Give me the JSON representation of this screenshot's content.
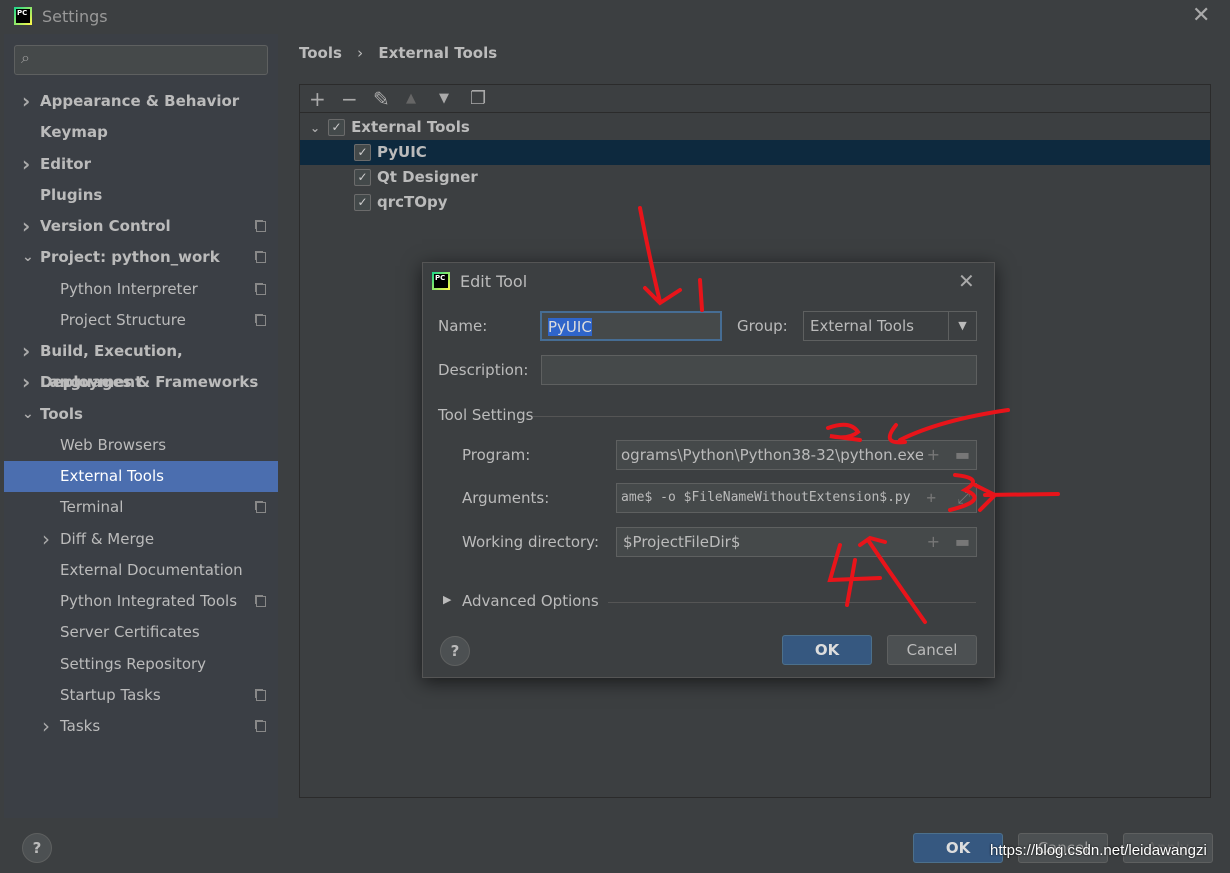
{
  "window": {
    "title": "Settings"
  },
  "search": {
    "placeholder": ""
  },
  "sidebar": {
    "items": [
      {
        "label": "Appearance & Behavior",
        "bold": true,
        "expand": ">"
      },
      {
        "label": "Keymap",
        "bold": true
      },
      {
        "label": "Editor",
        "bold": true,
        "expand": ">"
      },
      {
        "label": "Plugins",
        "bold": true
      },
      {
        "label": "Version Control",
        "bold": true,
        "expand": ">",
        "copy": true
      },
      {
        "label": "Project: python_work",
        "bold": true,
        "expand": "v",
        "copy": true
      },
      {
        "label": "Python Interpreter",
        "sub": true,
        "copy": true
      },
      {
        "label": "Project Structure",
        "sub": true,
        "copy": true
      },
      {
        "label": "Build, Execution, Deployment",
        "bold": true,
        "expand": ">"
      },
      {
        "label": "Languages & Frameworks",
        "bold": true,
        "expand": ">"
      },
      {
        "label": "Tools",
        "bold": true,
        "expand": "v"
      },
      {
        "label": "Web Browsers",
        "sub": true
      },
      {
        "label": "External Tools",
        "sub": true,
        "selected": true
      },
      {
        "label": "Terminal",
        "sub": true,
        "copy": true
      },
      {
        "label": "Diff & Merge",
        "sub": true,
        "expand": ">"
      },
      {
        "label": "External Documentation",
        "sub": true
      },
      {
        "label": "Python Integrated Tools",
        "sub": true,
        "copy": true
      },
      {
        "label": "Server Certificates",
        "sub": true
      },
      {
        "label": "Settings Repository",
        "sub": true
      },
      {
        "label": "Startup Tasks",
        "sub": true,
        "copy": true
      },
      {
        "label": "Tasks",
        "sub": true,
        "expand": ">",
        "copy": true
      }
    ]
  },
  "breadcrumb": {
    "parent": "Tools",
    "sep": "›",
    "current": "External Tools"
  },
  "toolbar": {
    "add": "+",
    "remove": "−",
    "edit": "✎",
    "up": "▲",
    "down": "▼",
    "copy": "❐"
  },
  "tree": {
    "group": "External Tools",
    "items": [
      "PyUIC",
      "Qt Designer",
      "qrcTOpy"
    ],
    "selected": "PyUIC"
  },
  "dialog": {
    "title": "Edit Tool",
    "name_label": "Name:",
    "name_value": "PyUIC",
    "group_label": "Group:",
    "group_value": "External Tools",
    "description_label": "Description:",
    "description_value": "",
    "section": "Tool Settings",
    "program_label": "Program:",
    "program_value": "ograms\\Python\\Python38-32\\python.exe",
    "arguments_label": "Arguments:",
    "arguments_value": "ame$ -o $FileNameWithoutExtension$.py",
    "workdir_label": "Working directory:",
    "workdir_value": "$ProjectFileDir$",
    "advanced": "Advanced Options",
    "ok": "OK",
    "cancel": "Cancel",
    "help": "?"
  },
  "footer": {
    "ok": "OK",
    "cancel": "Cancel",
    "apply": "Apply",
    "help": "?"
  },
  "annotations": {
    "labels": [
      "1",
      "2",
      "3",
      "4"
    ],
    "color": "#e8141a"
  },
  "watermark": "https://blog.csdn.net/leidawangzi",
  "colors": {
    "selection": "#4b6eaf",
    "tree_selection": "#0d293e",
    "ok_button": "#365880"
  }
}
